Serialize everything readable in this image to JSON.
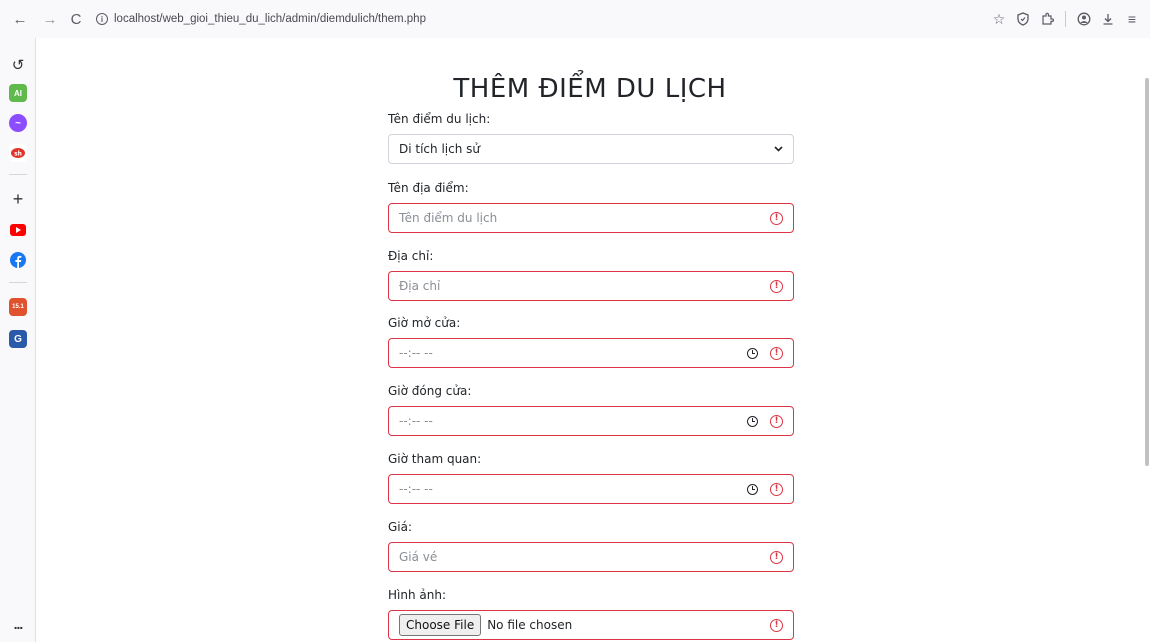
{
  "browser": {
    "url": "localhost/web_gioi_thieu_du_lich/admin/diemdulich/them.php",
    "nav": {
      "back": "←",
      "forward": "→",
      "reload": "C"
    },
    "right_icons": [
      "star-icon",
      "shield-icon",
      "extensions-icon",
      "account-icon",
      "download-icon",
      "menu-icon"
    ]
  },
  "sidebar": {
    "items": [
      {
        "name": "history-icon",
        "glyph": "↺",
        "color": "#ffffff"
      },
      {
        "name": "ai-icon",
        "glyph": "AI",
        "color": "#5fb94c"
      },
      {
        "name": "messenger-icon",
        "glyph": "m",
        "color": "#8b4dff"
      },
      {
        "name": "app-icon",
        "glyph": "s",
        "color": "#e2332a"
      },
      {
        "name": "add-icon",
        "glyph": "+",
        "color": "#ffffff"
      },
      {
        "name": "youtube-icon",
        "glyph": "▶",
        "color": "#ff0000"
      },
      {
        "name": "facebook-icon",
        "glyph": "f",
        "color": "#1877f2"
      },
      {
        "name": "calendar-icon",
        "glyph": "15.1",
        "color": "#e0512e"
      },
      {
        "name": "game-icon",
        "glyph": "G",
        "color": "#2a5ba8"
      }
    ],
    "more": "..."
  },
  "form": {
    "title": "THÊM ĐIỂM DU LỊCH",
    "category_label": "Tên điểm du lịch:",
    "category_value": "Di tích lịch sử",
    "name_label": "Tên địa điểm:",
    "name_placeholder": "Tên điểm du lịch",
    "address_label": "Địa chỉ:",
    "address_placeholder": "Địa chỉ",
    "open_label": "Giờ mở cửa:",
    "open_placeholder": "--:-- --",
    "close_label": "Giờ đóng cửa:",
    "close_placeholder": "--:-- --",
    "visit_label": "Giờ tham quan:",
    "visit_placeholder": "--:-- --",
    "price_label": "Giá:",
    "price_placeholder": "Giá vé",
    "image_label": "Hình ảnh:",
    "file_button": "Choose File",
    "file_status": "No file chosen",
    "error_glyph": "!",
    "error_color": "#dc3545"
  }
}
